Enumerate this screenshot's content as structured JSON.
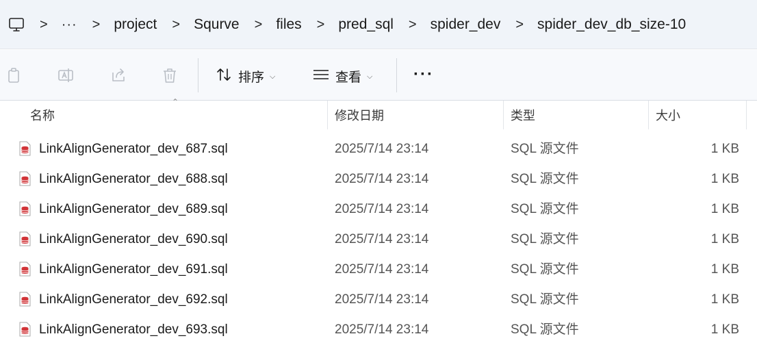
{
  "breadcrumb": {
    "more": "···",
    "separator": ">",
    "items": [
      "project",
      "Squrve",
      "files",
      "pred_sql",
      "spider_dev",
      "spider_dev_db_size-10"
    ]
  },
  "toolbar": {
    "sort_label": "排序",
    "view_label": "查看",
    "more": "···"
  },
  "columns": {
    "name": "名称",
    "date": "修改日期",
    "type": "类型",
    "size": "大小"
  },
  "files": [
    {
      "name": "LinkAlignGenerator_dev_687.sql",
      "date": "2025/7/14 23:14",
      "type": "SQL 源文件",
      "size": "1 KB"
    },
    {
      "name": "LinkAlignGenerator_dev_688.sql",
      "date": "2025/7/14 23:14",
      "type": "SQL 源文件",
      "size": "1 KB"
    },
    {
      "name": "LinkAlignGenerator_dev_689.sql",
      "date": "2025/7/14 23:14",
      "type": "SQL 源文件",
      "size": "1 KB"
    },
    {
      "name": "LinkAlignGenerator_dev_690.sql",
      "date": "2025/7/14 23:14",
      "type": "SQL 源文件",
      "size": "1 KB"
    },
    {
      "name": "LinkAlignGenerator_dev_691.sql",
      "date": "2025/7/14 23:14",
      "type": "SQL 源文件",
      "size": "1 KB"
    },
    {
      "name": "LinkAlignGenerator_dev_692.sql",
      "date": "2025/7/14 23:14",
      "type": "SQL 源文件",
      "size": "1 KB"
    },
    {
      "name": "LinkAlignGenerator_dev_693.sql",
      "date": "2025/7/14 23:14",
      "type": "SQL 源文件",
      "size": "1 KB"
    }
  ],
  "icons": {
    "address": "this-pc-icon",
    "toolbar": [
      "copy-icon",
      "rename-icon",
      "share-icon",
      "delete-icon",
      "sort-icon",
      "view-icon"
    ],
    "file": "sql-file-icon"
  },
  "colors": {
    "sql_icon": "#d13438",
    "toolbar_icon_disabled": "#b9bec5",
    "address_bg": "#f0f4f9"
  }
}
